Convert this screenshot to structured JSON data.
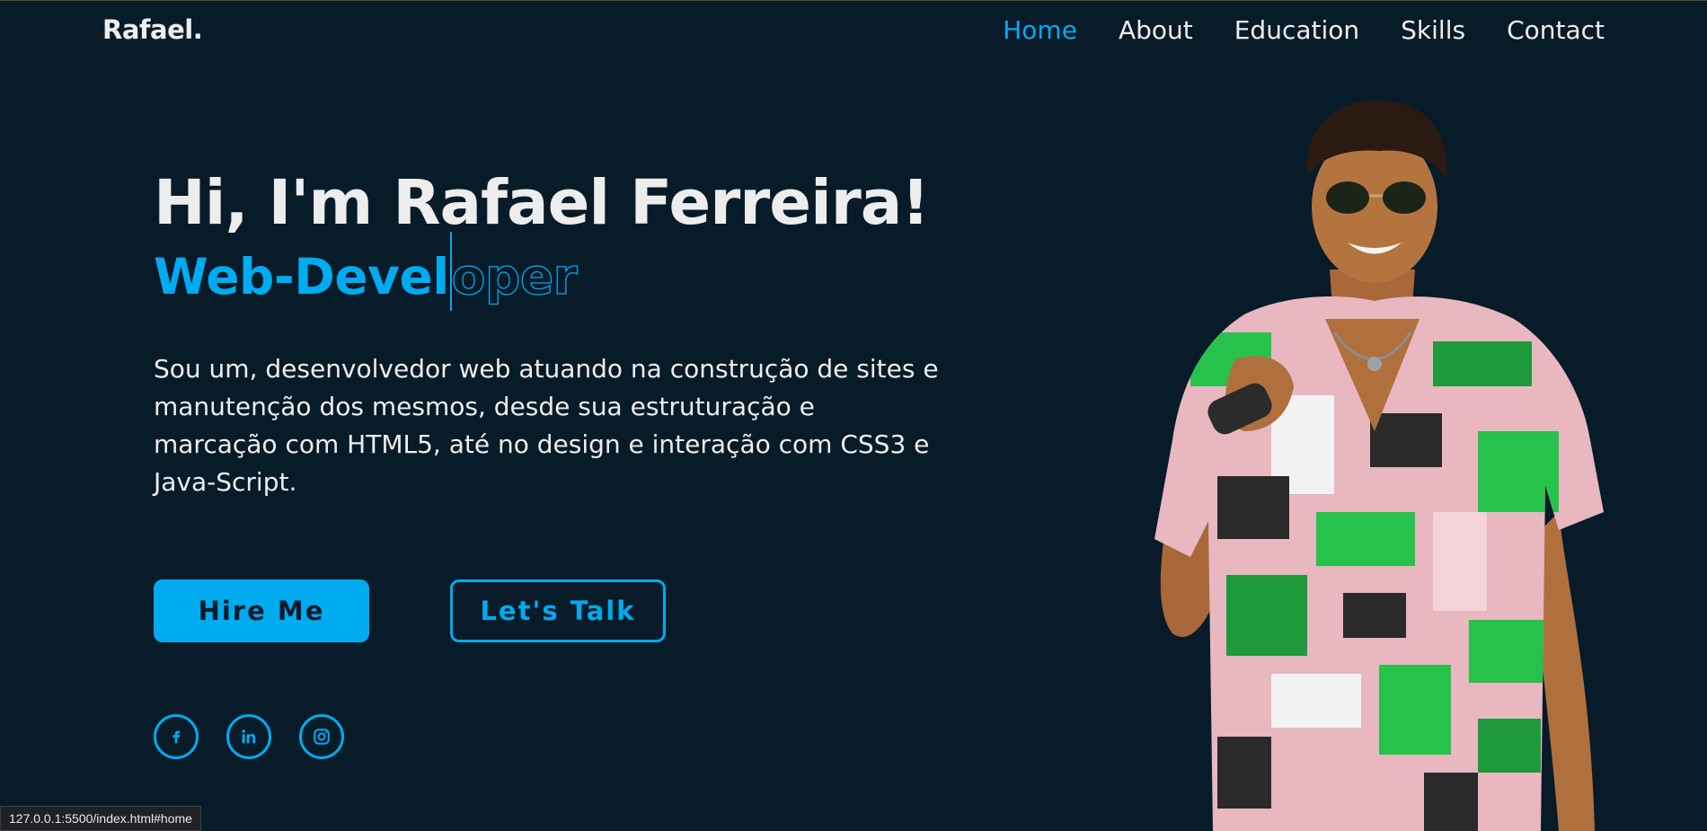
{
  "header": {
    "logo": "Rafael.",
    "nav": [
      {
        "label": "Home",
        "active": true
      },
      {
        "label": "About",
        "active": false
      },
      {
        "label": "Education",
        "active": false
      },
      {
        "label": "Skills",
        "active": false
      },
      {
        "label": "Contact",
        "active": false
      }
    ]
  },
  "hero": {
    "greeting": "Hi, I'm Rafael Ferreira!",
    "role_filled": "Web-Devel",
    "role_outline": "oper",
    "description": "Sou um, desenvolvedor web atuando na construção de sites e manutenção dos mesmos, desde sua estruturação e marcação com HTML5, até no design e interação com CSS3 e Java-Script.",
    "buttons": {
      "primary": "Hire Me",
      "secondary": "Let's Talk"
    },
    "socials": [
      {
        "icon": "facebook-icon"
      },
      {
        "icon": "linkedin-icon"
      },
      {
        "icon": "instagram-icon"
      }
    ]
  },
  "status_bar": {
    "url": "127.0.0.1:5500/index.html#home"
  },
  "colors": {
    "background": "#081b29",
    "accent": "#00abf0",
    "text": "#ededed"
  }
}
